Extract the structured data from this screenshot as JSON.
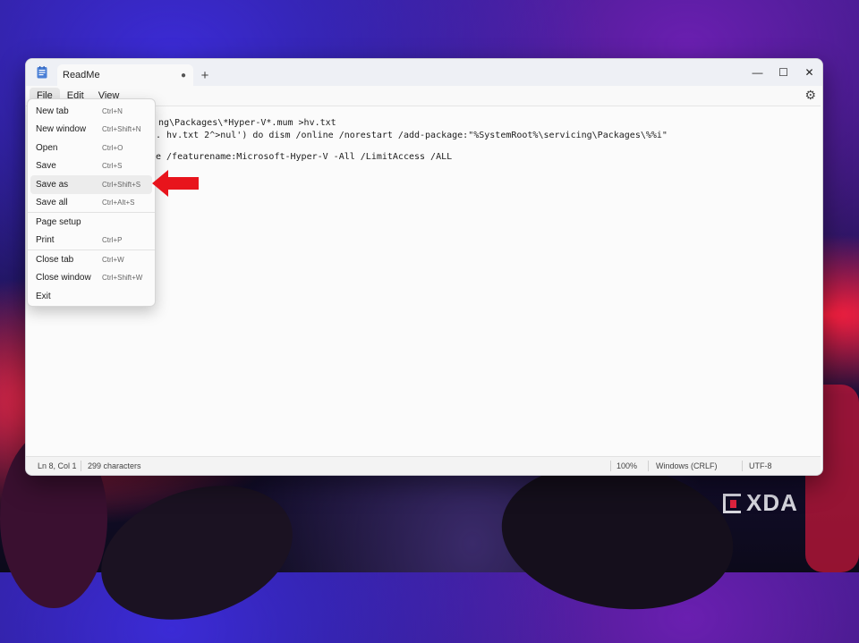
{
  "window": {
    "tab_title": "ReadMe",
    "tab_close_glyph": "●",
    "new_tab_glyph": "+",
    "controls": {
      "minimize": "—",
      "maximize": "☐",
      "close": "✕"
    }
  },
  "menubar": {
    "items": [
      "File",
      "Edit",
      "View"
    ],
    "settings_icon": "⚙"
  },
  "editor": {
    "lines": [
      "ng\\Packages\\*Hyper-V*.mum >hv.txt",
      ". hv.txt 2^>nul') do dism /online /norestart /add-package:\"%SystemRoot%\\servicing\\Packages\\%%i\"",
      "e /featurename:Microsoft-Hyper-V -All /LimitAccess /ALL"
    ]
  },
  "file_menu": {
    "items": [
      {
        "label": "New tab",
        "shortcut": "Ctrl+N"
      },
      {
        "label": "New window",
        "shortcut": "Ctrl+Shift+N"
      },
      {
        "label": "Open",
        "shortcut": "Ctrl+O"
      },
      {
        "label": "Save",
        "shortcut": "Ctrl+S"
      },
      {
        "label": "Save as",
        "shortcut": "Ctrl+Shift+S"
      },
      {
        "label": "Save all",
        "shortcut": "Ctrl+Alt+S"
      },
      {
        "label": "Page setup",
        "shortcut": ""
      },
      {
        "label": "Print",
        "shortcut": "Ctrl+P"
      },
      {
        "label": "Close tab",
        "shortcut": "Ctrl+W"
      },
      {
        "label": "Close window",
        "shortcut": "Ctrl+Shift+W"
      },
      {
        "label": "Exit",
        "shortcut": ""
      }
    ]
  },
  "statusbar": {
    "position": "Ln 8, Col 1",
    "characters": "299 characters",
    "zoom": "100%",
    "line_ending": "Windows (CRLF)",
    "encoding": "UTF-8"
  },
  "watermark": {
    "text": "XDA"
  },
  "colors": {
    "arrow": "#e8141c",
    "accent": "#e2233f"
  }
}
